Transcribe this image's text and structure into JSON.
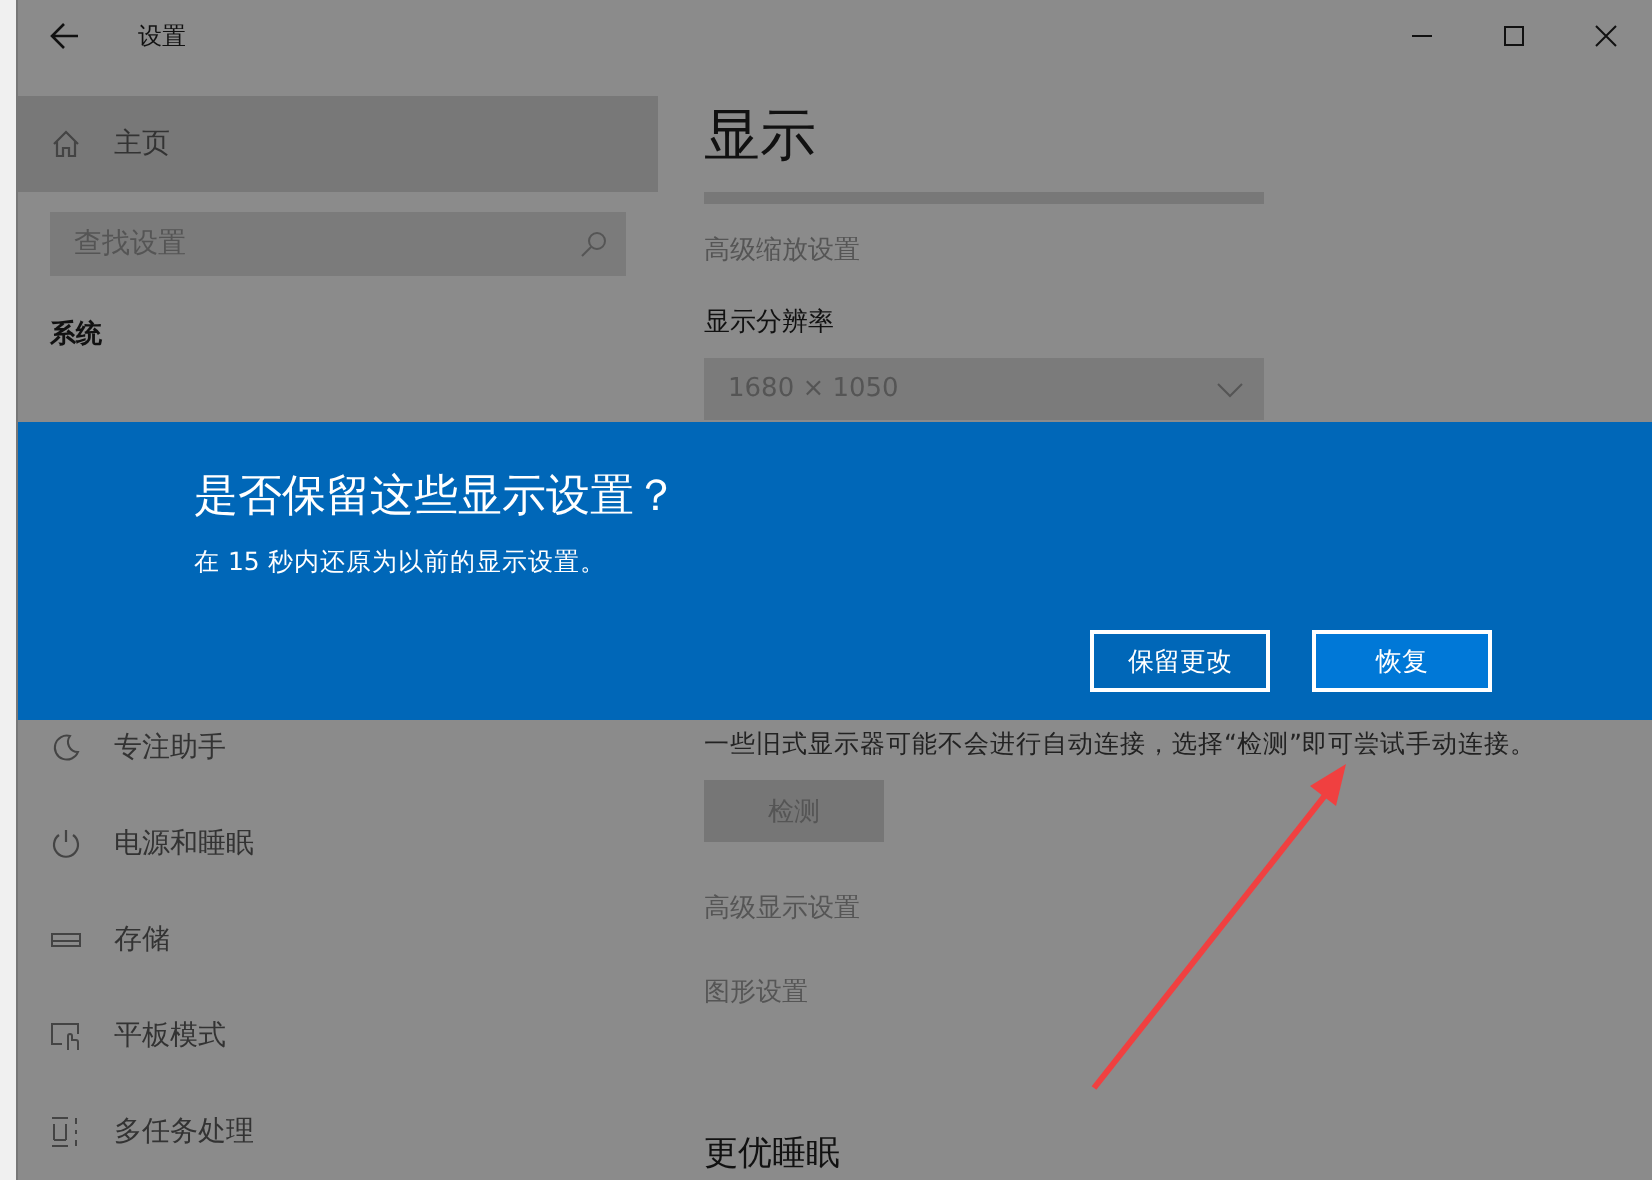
{
  "window": {
    "title": "设置"
  },
  "sidebar": {
    "home": {
      "label": "主页",
      "selected": true
    },
    "search": {
      "placeholder": "查找设置"
    },
    "section": "系统",
    "items": [
      {
        "label": "专注助手",
        "selected": false
      },
      {
        "label": "电源和睡眠",
        "selected": false
      },
      {
        "label": "存储",
        "selected": false
      },
      {
        "label": "平板模式",
        "selected": false
      },
      {
        "label": "多任务处理",
        "selected": false
      }
    ]
  },
  "content": {
    "title": "显示",
    "scale_link": "高级缩放设置",
    "resolution": {
      "label": "显示分辨率",
      "value": "1680 × 1050"
    },
    "note": "一些旧式显示器可能不会进行自动连接，选择“检测”即可尝试手动连接。",
    "detect_button": "检测",
    "links": [
      "高级显示设置",
      "图形设置"
    ],
    "next_heading": "更优睡眠"
  },
  "dialog": {
    "title": "是否保留这些显示设置？",
    "message": "在 15 秒内还原为以前的显示设置。",
    "buttons": [
      {
        "label": "保留更改",
        "selected": false
      },
      {
        "label": "恢复",
        "selected": true
      }
    ]
  }
}
